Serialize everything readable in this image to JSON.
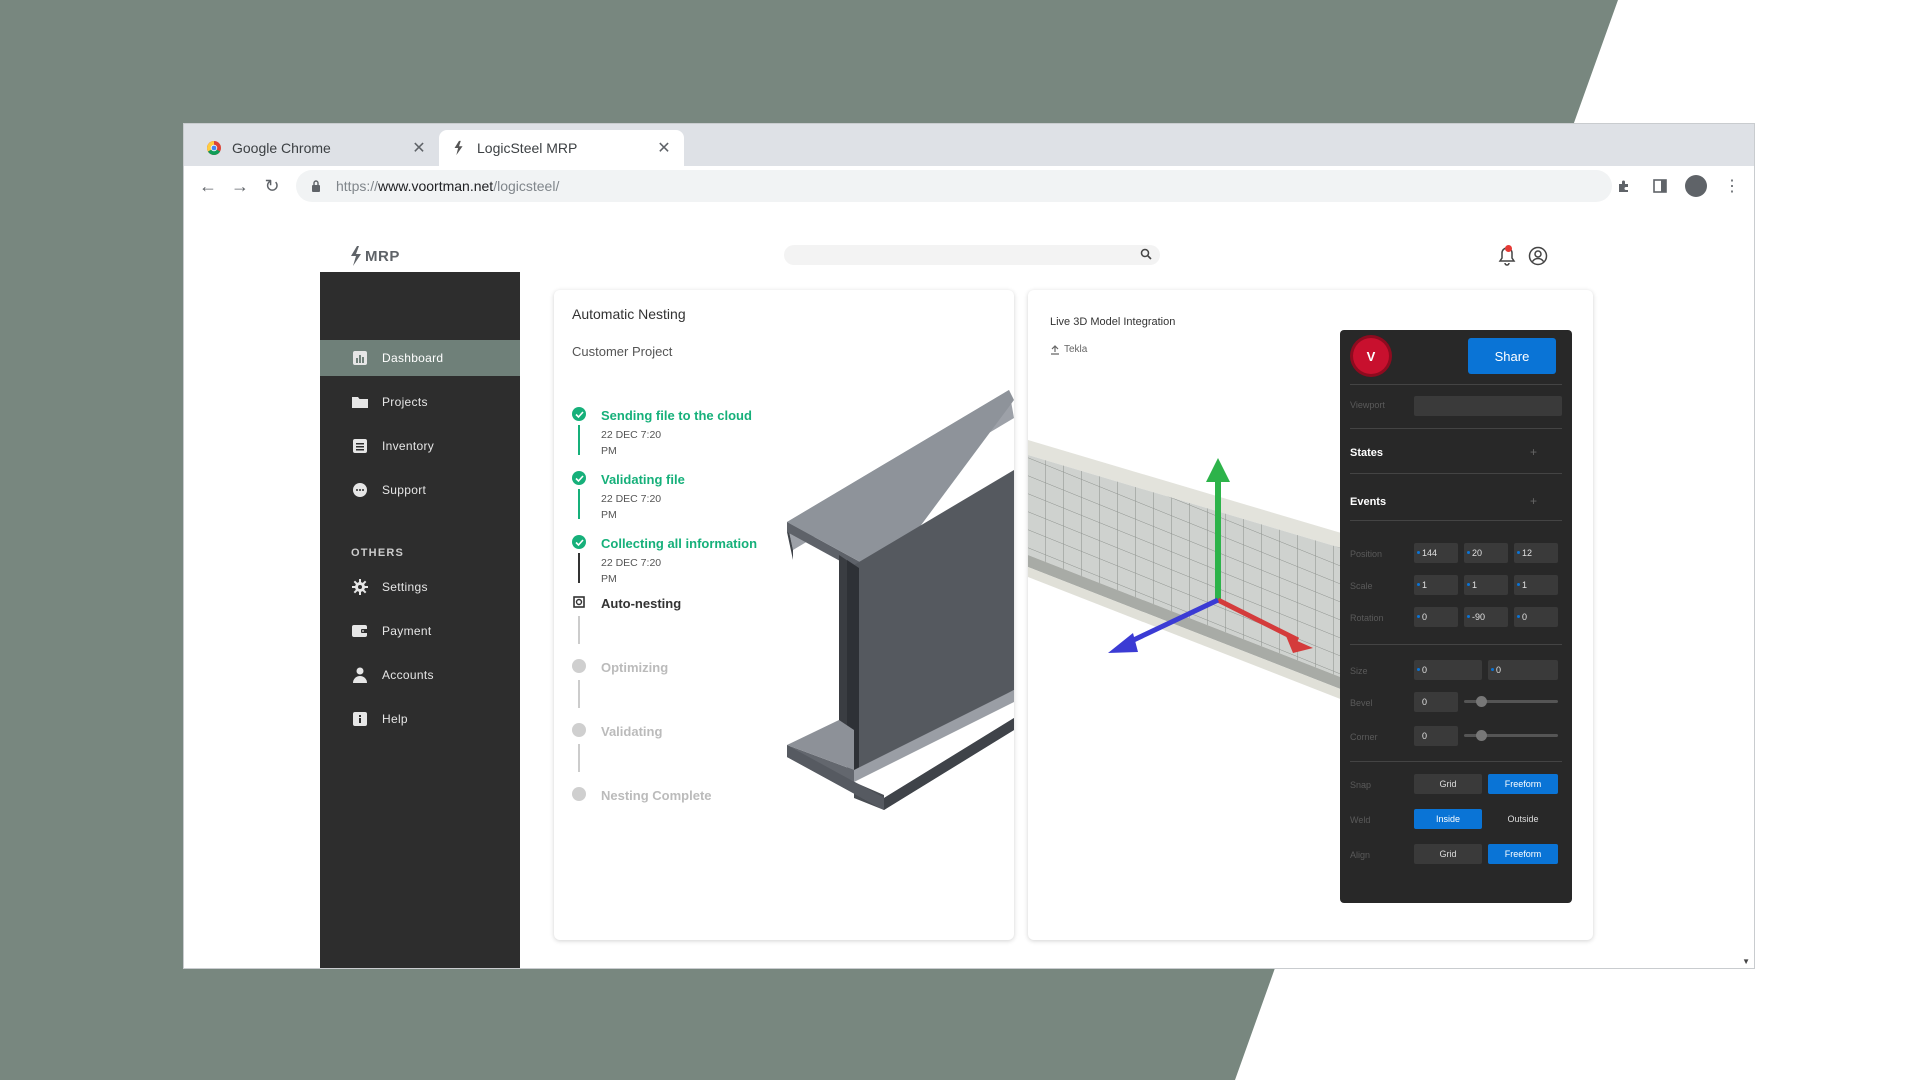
{
  "colors": {
    "background": "#78877f",
    "accent": "#0a74d6",
    "success": "#16b07a",
    "sidebar": "#2d2d2d",
    "active_item": "#6f8079",
    "avatar": "#c8102e"
  },
  "browser": {
    "tabs": [
      {
        "label": "Google Chrome",
        "icon": "chrome-icon"
      },
      {
        "label": "LogicSteel MRP",
        "icon": "logicsteel-icon"
      }
    ],
    "url": {
      "scheme": "https://",
      "host": "www.voortman.net",
      "path": "/logicsteel/"
    }
  },
  "app": {
    "logo_text": "MRP"
  },
  "sidebar": {
    "items": [
      {
        "label": "Dashboard",
        "icon": "chart-icon"
      },
      {
        "label": "Projects",
        "icon": "folder-icon"
      },
      {
        "label": "Inventory",
        "icon": "list-icon"
      },
      {
        "label": "Support",
        "icon": "chat-icon"
      }
    ],
    "section_label": "OTHERS",
    "other_items": [
      {
        "label": "Settings",
        "icon": "gear-icon"
      },
      {
        "label": "Payment",
        "icon": "wallet-icon"
      },
      {
        "label": "Accounts",
        "icon": "person-icon"
      },
      {
        "label": "Help",
        "icon": "info-icon"
      }
    ]
  },
  "nesting": {
    "title": "Automatic Nesting",
    "subtitle": "Customer Project",
    "steps": [
      {
        "label": "Sending file to the cloud",
        "time": "22 DEC 7:20",
        "ampm": "PM",
        "status": "done"
      },
      {
        "label": "Validating file",
        "time": "22 DEC 7:20",
        "ampm": "PM",
        "status": "done"
      },
      {
        "label": "Collecting all information",
        "time": "22 DEC 7:20",
        "ampm": "PM",
        "status": "done"
      },
      {
        "label": "Auto-nesting",
        "status": "current"
      },
      {
        "label": "Optimizing",
        "status": "pending"
      },
      {
        "label": "Validating",
        "status": "pending"
      },
      {
        "label": "Nesting Complete",
        "status": "pending"
      }
    ]
  },
  "model": {
    "title": "Live 3D Model Integration",
    "source": "Tekla",
    "panel": {
      "avatar_letter": "V",
      "share_label": "Share",
      "viewport_label": "Viewport",
      "states_label": "States",
      "events_label": "Events",
      "plus": "+",
      "position_label": "Position",
      "position": [
        "144",
        "20",
        "12"
      ],
      "scale_label": "Scale",
      "scale": [
        "1",
        "1",
        "1"
      ],
      "rotation_label": "Rotation",
      "rotation": [
        "0",
        "-90",
        "0"
      ],
      "size_label": "Size",
      "size": [
        "0",
        "0"
      ],
      "bevel_label": "Bevel",
      "bevel": "0",
      "corner_label": "Corner",
      "corner": "0",
      "snap_label": "Snap",
      "snap_options": [
        "Grid",
        "Freeform"
      ],
      "weld_label": "Weld",
      "weld_options": [
        "Inside",
        "Outside"
      ],
      "align_label": "Align",
      "align_options": [
        "Grid",
        "Freeform"
      ]
    }
  }
}
